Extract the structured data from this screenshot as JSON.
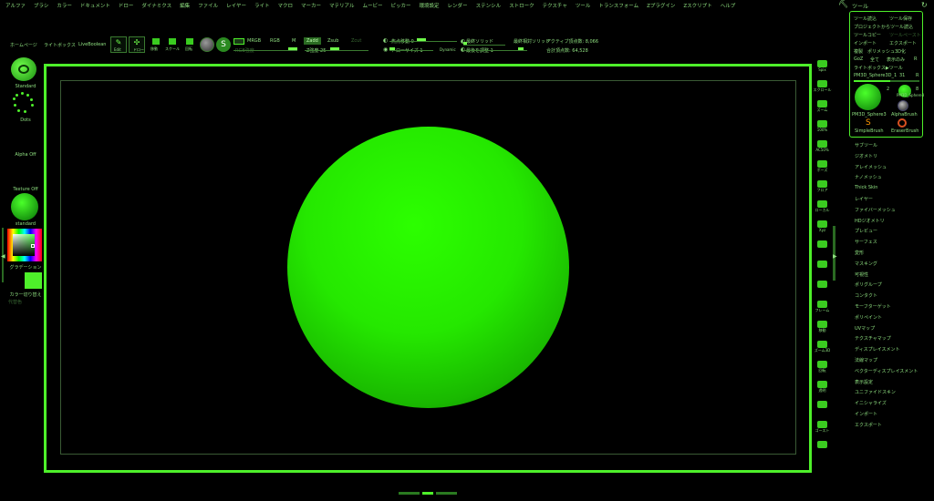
{
  "menu": [
    "アルファ",
    "ブラシ",
    "カラー",
    "ドキュメント",
    "ドロー",
    "ダイナミクス",
    "編集",
    "ファイル",
    "レイヤー",
    "ライト",
    "マクロ",
    "マーカー",
    "マテリアル",
    "ムービー",
    "ピッカー",
    "環境設定",
    "レンダー",
    "ステンシル",
    "ストローク",
    "テクスチャ",
    "ツール",
    "トランスフォーム",
    "Zプラグイン",
    "Zスクリプト",
    "ヘルプ"
  ],
  "tool_title": "ツール",
  "toolbar": {
    "home": "ホームページ",
    "lightbox": "ライトボックス",
    "liveboolean": "LiveBoolean",
    "edit": "Edit",
    "draw": "ドロー",
    "move": "移動",
    "scale": "スケール",
    "rotate": "回転",
    "mrgb": "MRGB",
    "rgb": "RGB",
    "m": "M",
    "zadd": "Zadd",
    "zsub": "Zsub",
    "zcut": "Zcut",
    "rgb_intensity": "RGB強度",
    "z_intensity": "Z強度 25",
    "focal_shift": "焦点移動 0",
    "draw_size": "ドローサイズ 1",
    "dynamic": "Dynamic",
    "active_points": "アクティブ頂点数: 8,066",
    "total_points": "合計頂点数: 64,528",
    "poly_1": "最終ソリッド",
    "poly_2": "最終相対ソリッド",
    "poly_3": "最後を調整 1"
  },
  "left_shelf": {
    "brush_name": "Standard",
    "stroke_name": "Dots",
    "alpha_name": "Alpha Off",
    "texture_name": "Texture Off",
    "material_name": "standard",
    "gradient": "グラデーション",
    "switch_color": "カラー切り替え",
    "alternate": "代替色"
  },
  "right_shelf": [
    "Spix",
    "スクロール",
    "ズーム",
    "100%",
    "AC50%",
    "ポーズ",
    "フロア",
    "ローカル",
    "Xyz",
    "",
    "",
    "",
    "フレーム",
    "移動",
    "ズーム3D",
    "回転",
    "透明",
    "",
    "ゴースト",
    ""
  ],
  "tool_panel": {
    "load": "ツール読込",
    "save": "ツール保存",
    "from_project": "プロジェクトからツール読込",
    "copy": "ツールコピー",
    "paste": "ツールペースト",
    "import": "インポート",
    "export": "エクスポート",
    "clone": "複製",
    "make_polymesh": "ポリメッシュ3D化",
    "goz": "GoZ",
    "all": "全て",
    "visible": "表示のみ",
    "r": "R",
    "lightbox_tools": "ライトボックス▶ツール",
    "current_tool": "PM3D_Sphere3D_1",
    "current_count": "31",
    "r2": "R",
    "thumb_count": "2",
    "thumb_count2": "8",
    "tools": [
      "PM3D_Sphere3",
      "AlphaBrush",
      "SimpleBrush",
      "EraserBrush"
    ],
    "thumb_label": "PM3D_Sphere3"
  },
  "subtool_list": [
    "サブツール",
    "ジオメトリ",
    "アレイメッシュ",
    "ナノメッシュ",
    "Thick Skin",
    "レイヤー",
    "ファイバーメッシュ",
    "HDジオメトリ",
    "プレビュー",
    "サーフェス",
    "変形",
    "マスキング",
    "可視性",
    "ポリグループ",
    "コンタクト",
    "モーフターゲット",
    "ポリペイント",
    "UVマップ",
    "テクスチャマップ",
    "ディスプレイスメント",
    "法線マップ",
    "ベクターディスプレイスメント",
    "表示設定",
    "ユニファイドスキン",
    "イニシャライズ",
    "インポート",
    "エクスポート"
  ],
  "colors": {
    "accent": "#4ef02a",
    "sphere": "#25e800",
    "text": "#8fe080"
  }
}
